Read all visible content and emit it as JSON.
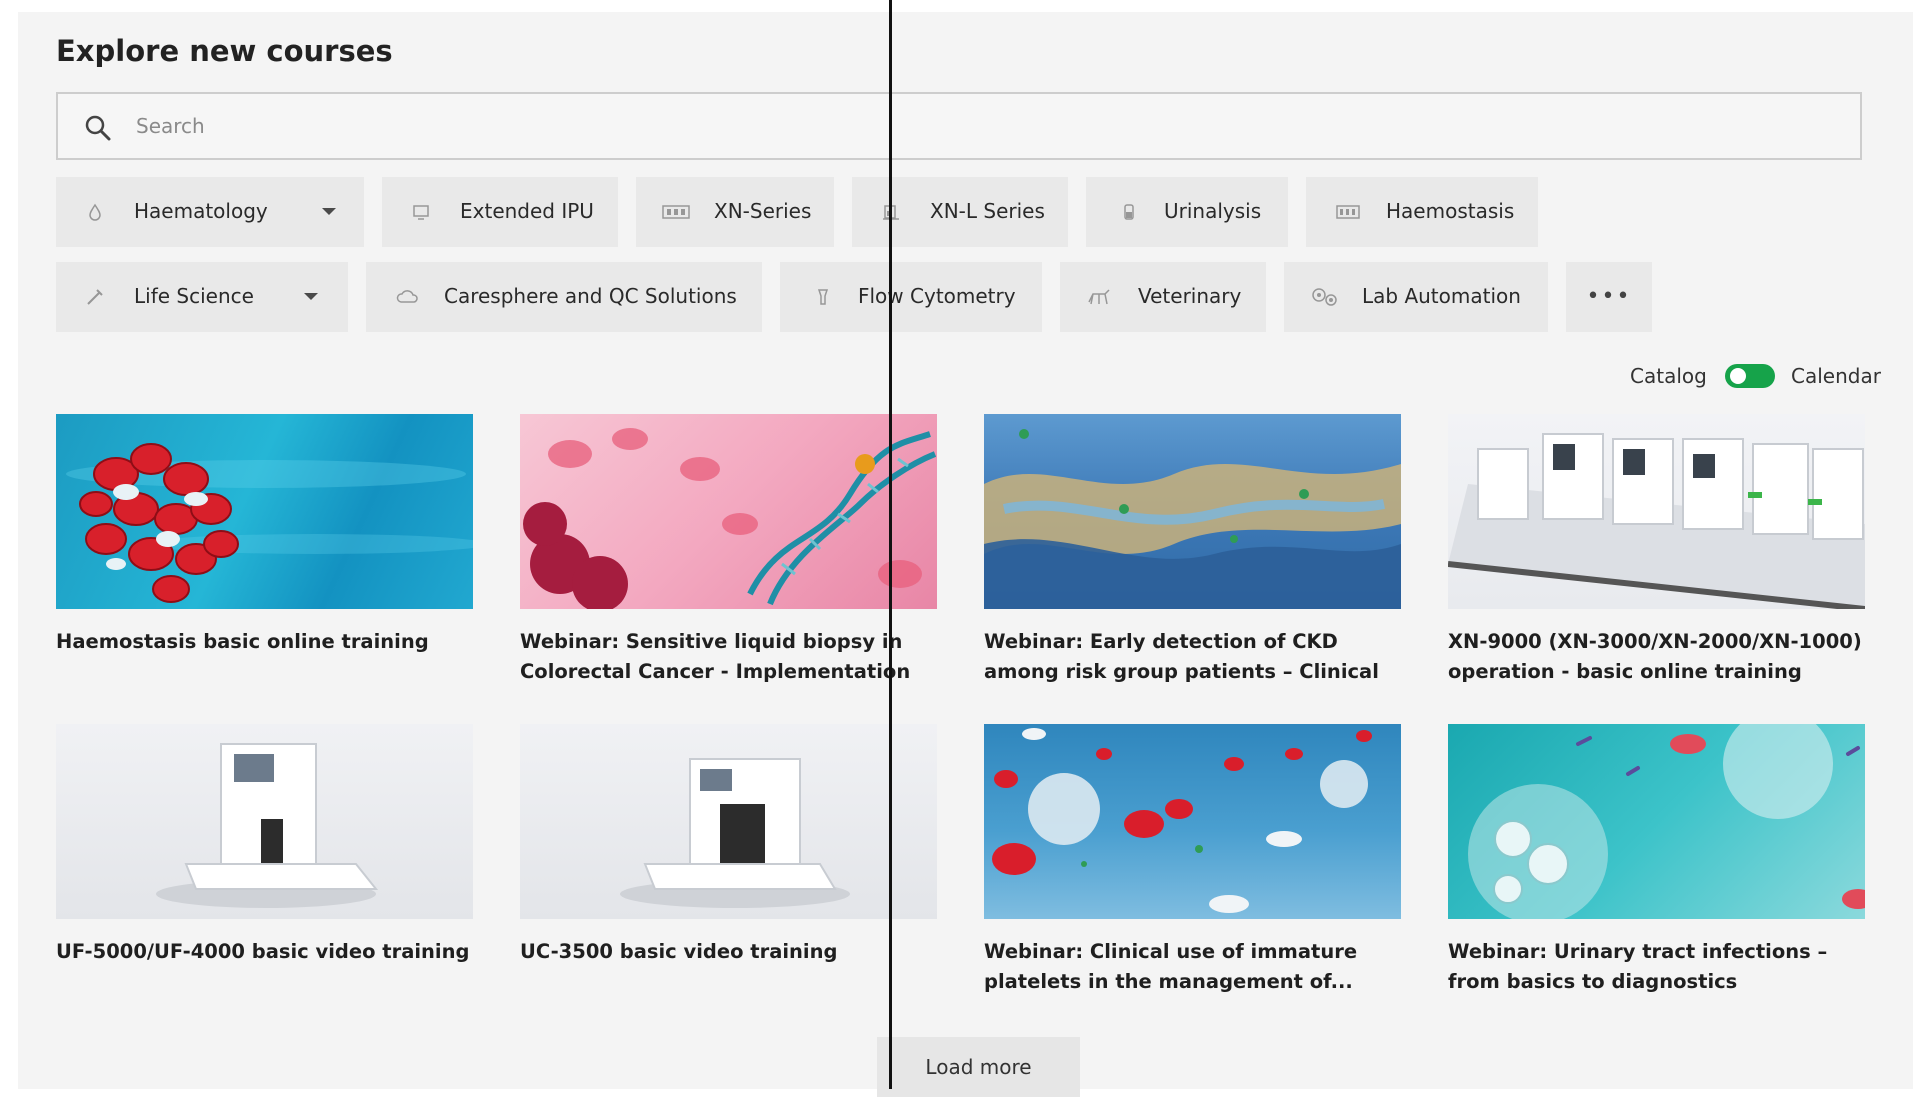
{
  "page": {
    "title": "Explore new courses"
  },
  "search": {
    "placeholder": "Search"
  },
  "filters": {
    "row1": [
      {
        "label": "Haematology",
        "icon": "drop-icon",
        "dropdown": true
      },
      {
        "label": "Extended IPU",
        "icon": "monitor-icon",
        "dropdown": false
      },
      {
        "label": "XN-Series",
        "icon": "analyzer-icon",
        "dropdown": false
      },
      {
        "label": "XN-L Series",
        "icon": "analyzer-small-icon",
        "dropdown": false
      },
      {
        "label": "Urinalysis",
        "icon": "tube-icon",
        "dropdown": false
      },
      {
        "label": "Haemostasis",
        "icon": "analyzer-icon",
        "dropdown": false
      }
    ],
    "row2": [
      {
        "label": "Life Science",
        "icon": "pipette-icon",
        "dropdown": true
      },
      {
        "label": "Caresphere and QC Solutions",
        "icon": "cloud-icon",
        "dropdown": false
      },
      {
        "label": "Flow Cytometry",
        "icon": "cytometer-icon",
        "dropdown": false
      },
      {
        "label": "Veterinary",
        "icon": "animal-icon",
        "dropdown": false
      },
      {
        "label": "Lab Automation",
        "icon": "gears-icon",
        "dropdown": false
      },
      {
        "label": "•••",
        "icon": "more-icon",
        "dropdown": false
      }
    ]
  },
  "view_toggle": {
    "left": "Catalog",
    "right": "Calendar",
    "accent": "#16a34a"
  },
  "courses": [
    {
      "title": "Haemostasis basic online training"
    },
    {
      "title": "Webinar: Sensitive liquid biopsy in Colorectal Cancer - Implementation ..."
    },
    {
      "title": "Webinar: Early detection of CKD among risk group patients – Clinical needs a..."
    },
    {
      "title": "XN-9000 (XN-3000/XN-2000/XN-1000) operation - basic online training"
    },
    {
      "title": "UF-5000/UF-4000 basic video training"
    },
    {
      "title": "UC-3500 basic video training"
    },
    {
      "title": "Webinar: Clinical use of immature platelets in the management of..."
    },
    {
      "title": "Webinar: Urinary tract infections – from basics to diagnostics"
    }
  ],
  "load_more": "Load more"
}
